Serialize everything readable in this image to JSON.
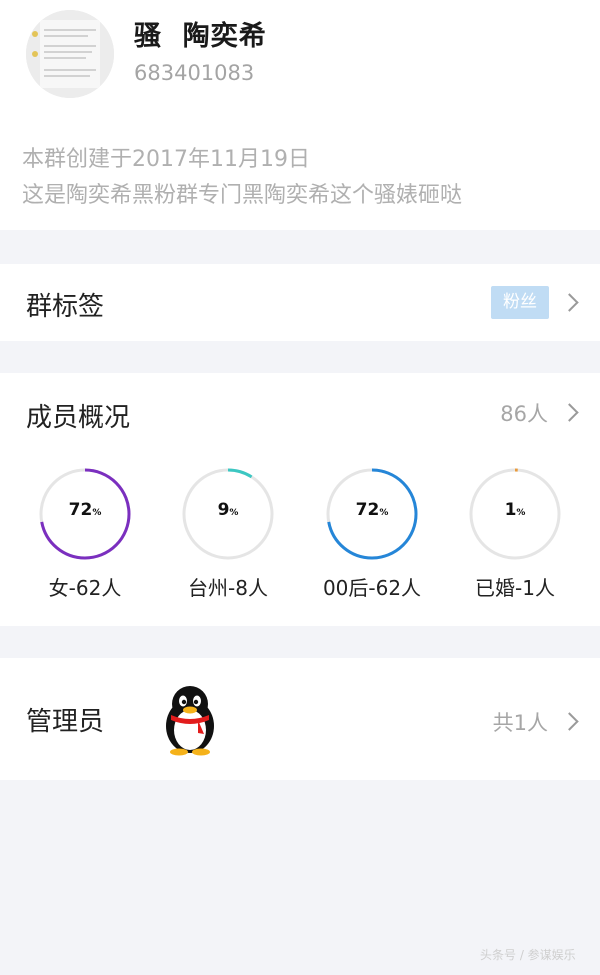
{
  "header": {
    "group_name": "骚  陶奕希",
    "group_id": "683401083",
    "description_line1": "本群创建于2017年11月19日",
    "description_line2": "这是陶奕希黑粉群专门黑陶奕希这个骚婊砸哒"
  },
  "tags": {
    "title": "群标签",
    "tag": "粉丝"
  },
  "members": {
    "title": "成员概况",
    "count": "86人",
    "stats": [
      {
        "percent": 72,
        "percent_text": "72",
        "label": "女-62人",
        "color": "#7b2fbf"
      },
      {
        "percent": 9,
        "percent_text": "9",
        "label": "台州-8人",
        "color": "#3cc7c2"
      },
      {
        "percent": 72,
        "percent_text": "72",
        "label": "00后-62人",
        "color": "#2586d8"
      },
      {
        "percent": 1,
        "percent_text": "1",
        "label": "已婚-1人",
        "color": "#e89a3c"
      }
    ],
    "percent_unit": "%"
  },
  "admins": {
    "title": "管理员",
    "count": "共1人"
  },
  "watermark": "头条号 / 参谋娱乐",
  "colors": {
    "background": "#f3f4f8",
    "tag_pill": "#c0dcf4",
    "ring_track": "#e5e5e5"
  }
}
